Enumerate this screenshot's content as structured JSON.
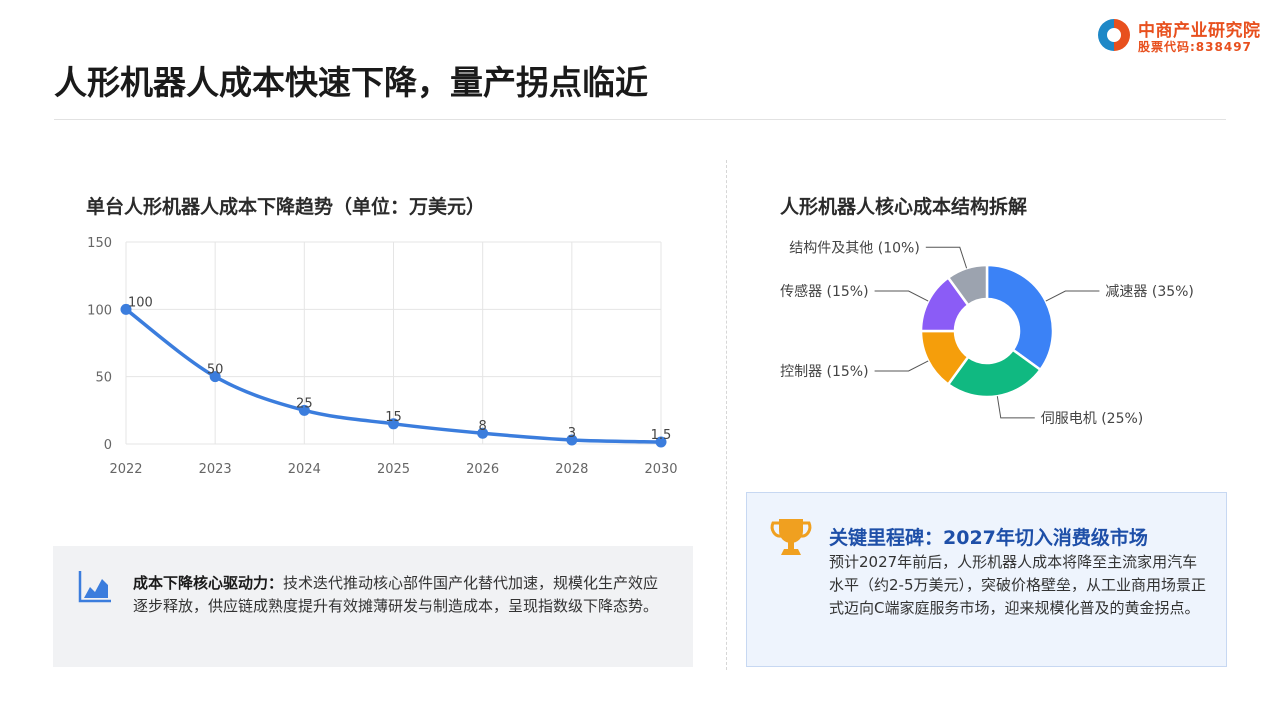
{
  "logo": {
    "name": "中商产业研究院",
    "stock_code": "股票代码:838497"
  },
  "page_title": "人形机器人成本快速下降，量产拐点临近",
  "chart_data": [
    {
      "type": "line",
      "title": "单台人形机器人成本下降趋势（单位：万美元）",
      "categories": [
        "2022",
        "2023",
        "2024",
        "2025",
        "2026",
        "2028",
        "2030"
      ],
      "series": [
        {
          "values": [
            100,
            50,
            25,
            15,
            8,
            3,
            1.5
          ]
        }
      ],
      "data_labels": [
        "100",
        "50",
        "25",
        "15",
        "8",
        "3",
        "1.5"
      ],
      "y_ticks": [
        "0",
        "50",
        "100",
        "150"
      ],
      "ylim": [
        0,
        150
      ],
      "grid": true,
      "line_color": "#3b7ddd"
    },
    {
      "type": "pie",
      "title": "人形机器人核心成本结构拆解",
      "donut": true,
      "slices": [
        {
          "label": "减速器 (35%)",
          "value": 35,
          "color": "#3b82f6"
        },
        {
          "label": "伺服电机 (25%)",
          "value": 25,
          "color": "#10b981"
        },
        {
          "label": "控制器 (15%)",
          "value": 15,
          "color": "#f59e0b"
        },
        {
          "label": "传感器 (15%)",
          "value": 15,
          "color": "#8b5cf6"
        },
        {
          "label": "结构件及其他 (10%)",
          "value": 10,
          "color": "#9ca3af"
        }
      ]
    }
  ],
  "driver_note": {
    "label": "成本下降核心驱动力：",
    "text": "技术迭代推动核心部件国产化替代加速，规模化生产效应逐步释放，供应链成熟度提升有效摊薄研发与制造成本，呈现指数级下降态势。"
  },
  "milestone": {
    "title": "关键里程碑：2027年切入消费级市场",
    "text": "预计2027年前后，人形机器人成本将降至主流家用汽车水平（约2-5万美元），突破价格壁垒，从工业商用场景正式迈向C端家庭服务市场，迎来规模化普及的黄金拐点。"
  },
  "colors": {
    "brand": "#e8501e",
    "brand_blue": "#1e88c7",
    "accent_blue": "#1e4fa8",
    "trophy": "#f0a020"
  },
  "icons": {
    "note": "area-chart-icon",
    "milestone": "trophy-icon"
  }
}
